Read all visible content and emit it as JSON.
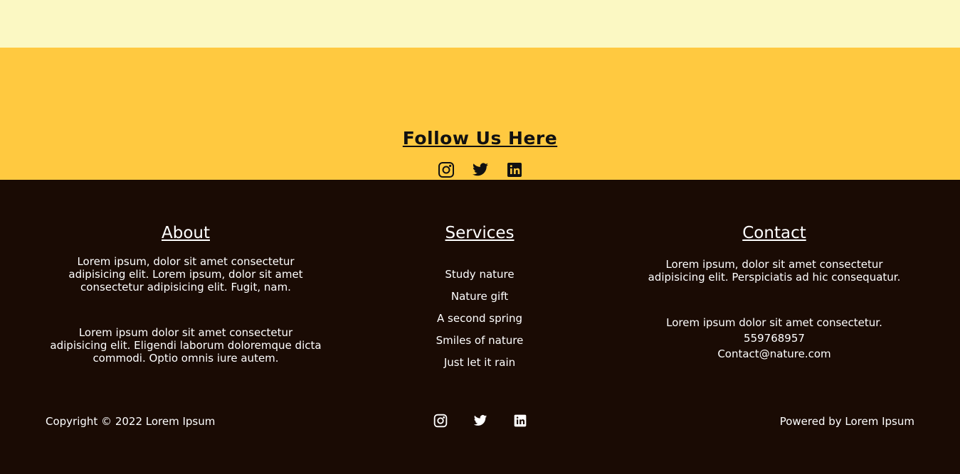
{
  "follow": {
    "heading": "Follow Us Here",
    "icons": [
      "instagram-icon",
      "twitter-icon",
      "linkedin-icon"
    ]
  },
  "about": {
    "heading": "About",
    "paragraph1": "Lorem ipsum, dolor sit amet consectetur adipisicing elit. Lorem ipsum, dolor sit amet consectetur adipisicing elit. Fugit, nam.",
    "paragraph2": "Lorem ipsum dolor sit amet consectetur adipisicing elit. Eligendi laborum doloremque dicta commodi. Optio omnis iure autem."
  },
  "services": {
    "heading": "Services",
    "items": [
      "Study nature",
      "Nature gift",
      "A second spring",
      "Smiles of nature",
      "Just let it rain"
    ]
  },
  "contact": {
    "heading": "Contact",
    "paragraph1": "Lorem ipsum, dolor sit amet consectetur adipisicing elit. Perspiciatis ad hic consequatur.",
    "paragraph2": "Lorem ipsum dolor sit amet consectetur.",
    "phone": "559768957",
    "email": "Contact@nature.com"
  },
  "bottom": {
    "copyright": "Copyright © 2022 Lorem Ipsum",
    "powered": "Powered by Lorem Ipsum"
  },
  "colors": {
    "top_band": "#fbf8c3",
    "follow_band": "#ffc940",
    "footer_bg": "#1a0b04",
    "text_light": "#ffffff",
    "text_dark": "#111111"
  }
}
